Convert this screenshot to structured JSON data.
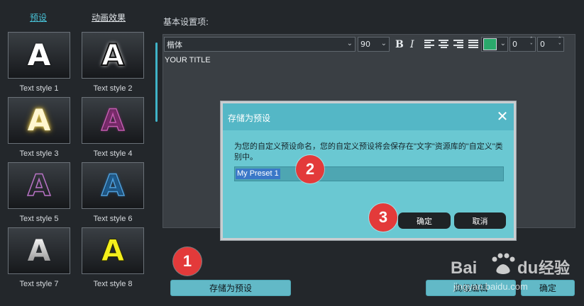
{
  "tabs": {
    "presets": "预设",
    "animation": "动画效果"
  },
  "presets": [
    {
      "glyph": "A",
      "label": "Text style 1"
    },
    {
      "glyph": "A",
      "label": "Text style 2"
    },
    {
      "glyph": "A",
      "label": "Text style 3"
    },
    {
      "glyph": "A",
      "label": "Text style 4"
    },
    {
      "glyph": "A",
      "label": "Text style 5"
    },
    {
      "glyph": "A",
      "label": "Text style 6"
    },
    {
      "glyph": "A",
      "label": "Text style 7"
    },
    {
      "glyph": "A",
      "label": "Text style 8"
    }
  ],
  "editor": {
    "section_label": "基本设置项:",
    "font": "楷体",
    "size": "90",
    "bold": "B",
    "italic": "I",
    "text_color": "#2aa86b",
    "spacing_a": "0",
    "spacing_b": "0",
    "content": "YOUR TITLE"
  },
  "buttons": {
    "save_preset": "存储为预设",
    "advanced": "高级编辑",
    "confirm": "确定"
  },
  "dialog": {
    "title": "存储为预设",
    "close": "✕",
    "message": "为您的自定义预设命名，您的自定义预设将会保存在\"文字\"资源库的\"自定义\"类别中。",
    "input_value": "My Preset 1",
    "ok": "确定",
    "cancel": "取消"
  },
  "annotations": [
    "1",
    "2",
    "3"
  ],
  "watermark": {
    "brand": "Bai du",
    "cn": "经验",
    "url": "jingyan.baidu.com"
  }
}
